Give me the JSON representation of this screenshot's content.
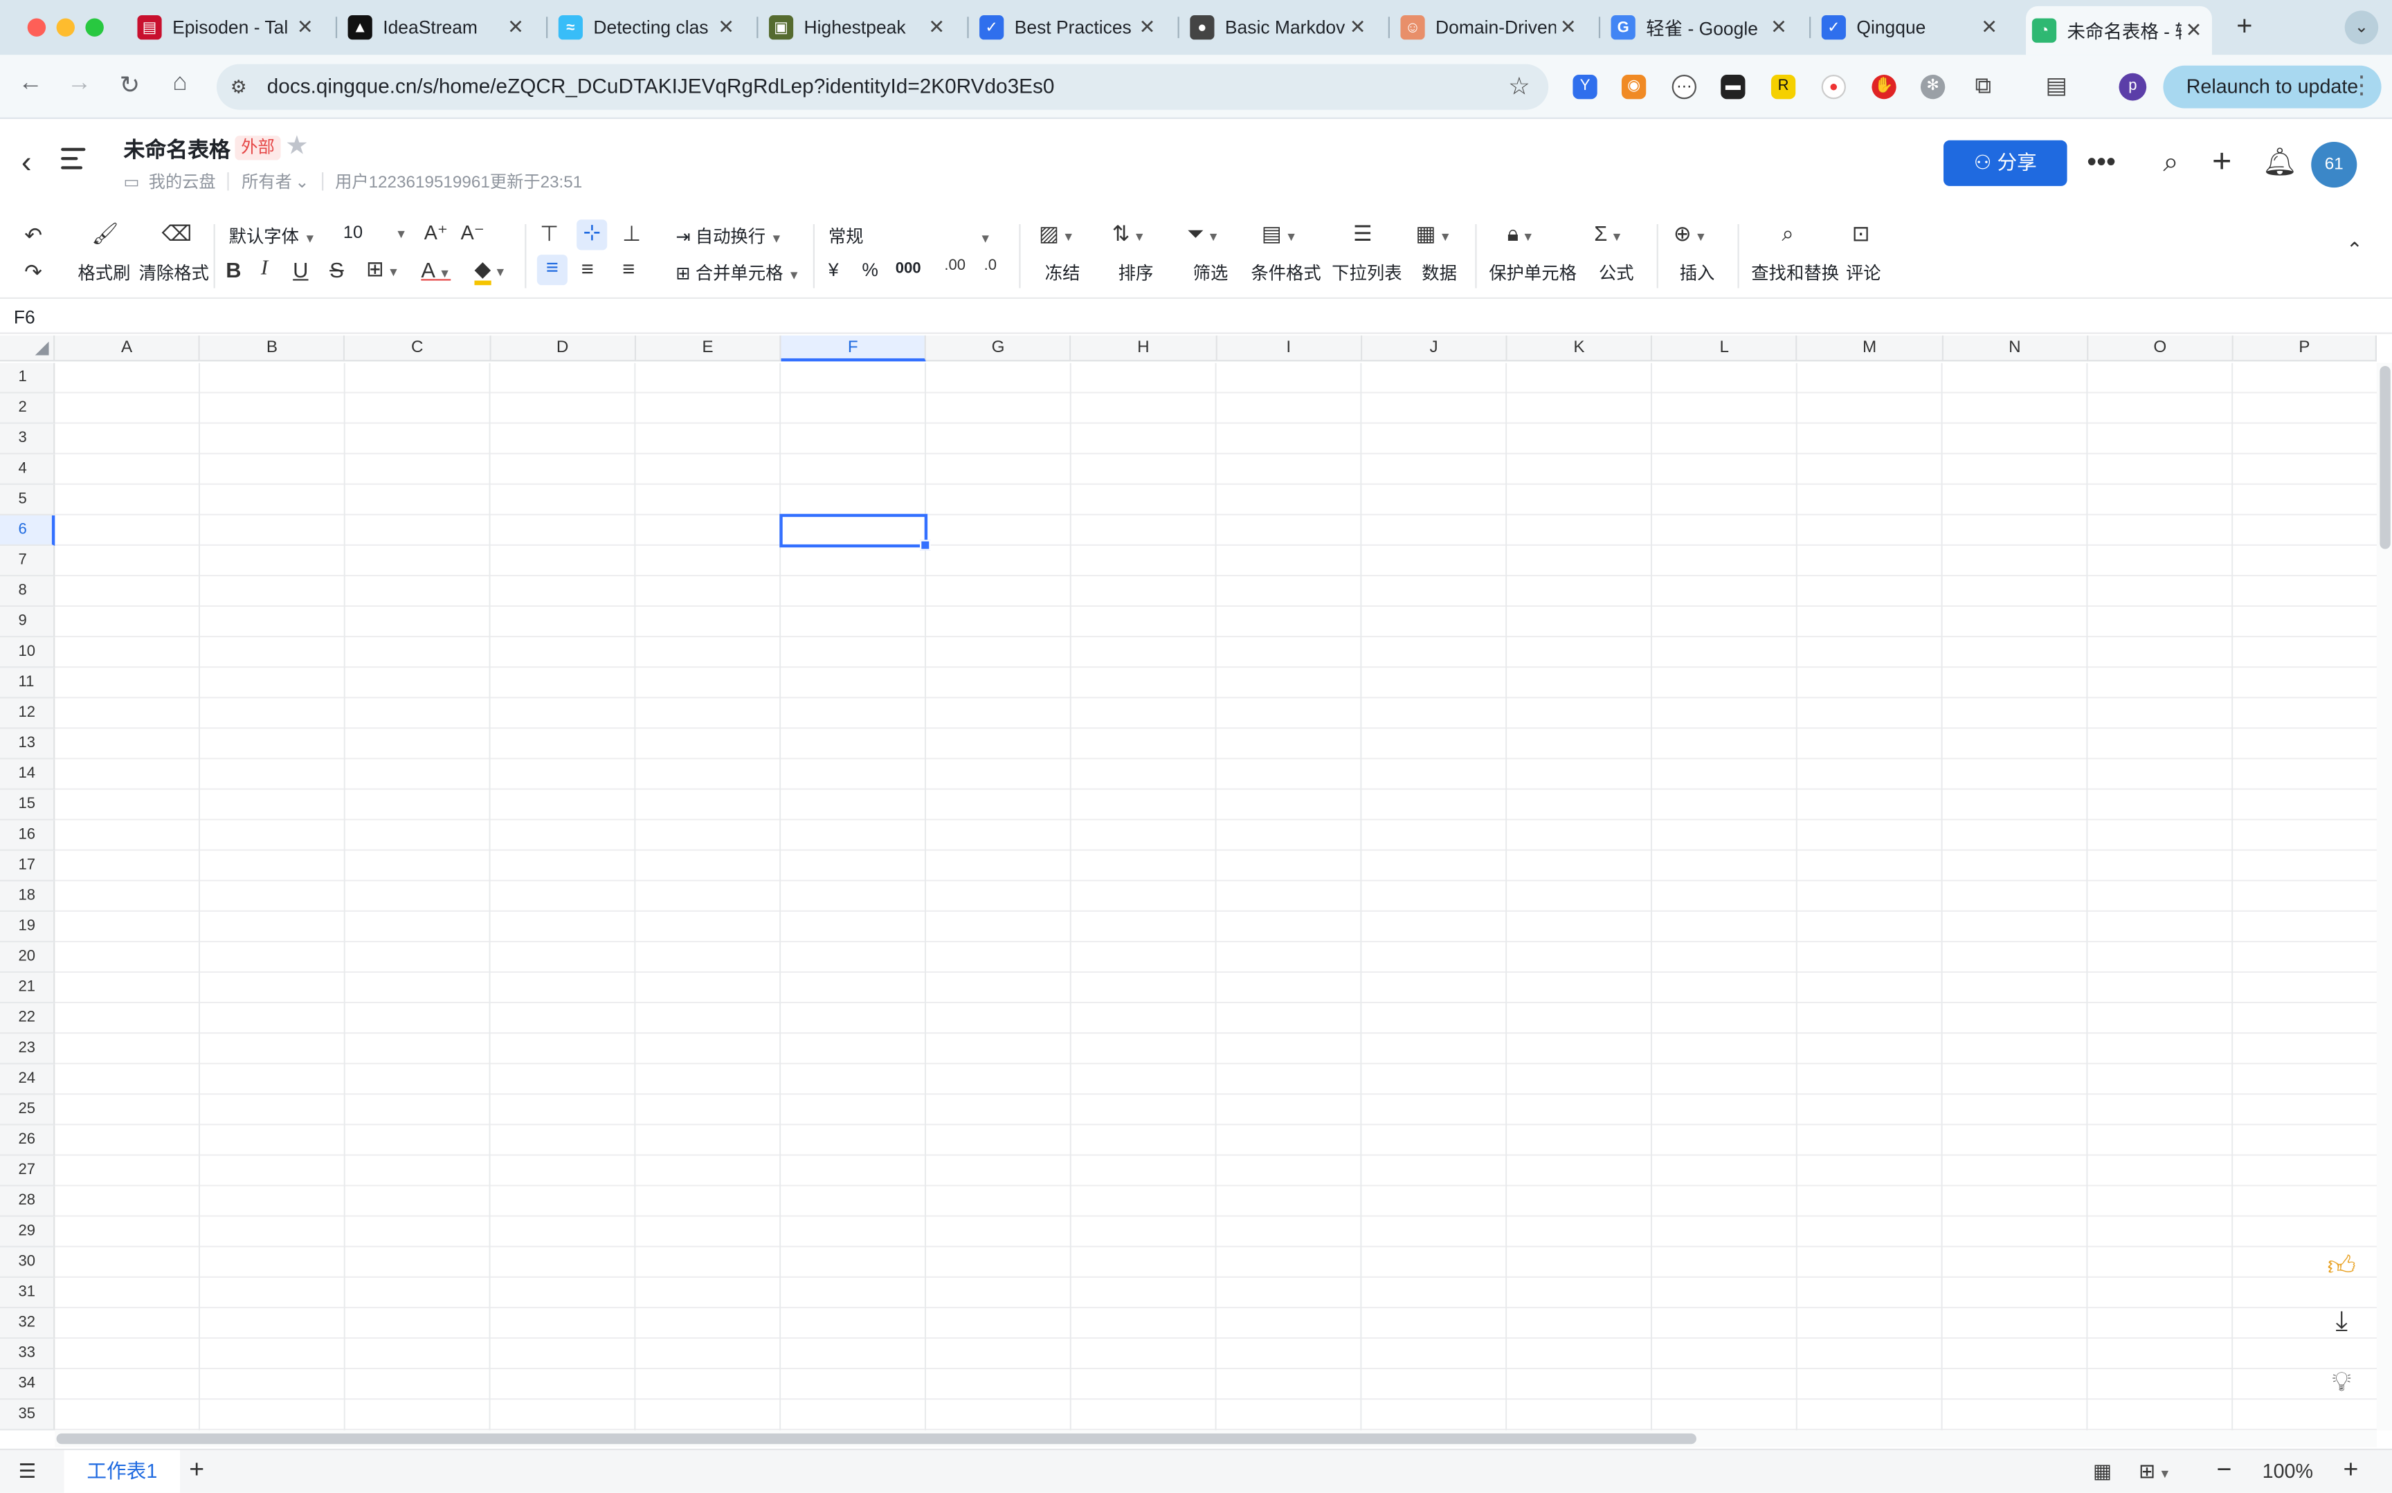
{
  "browser": {
    "tabs": [
      {
        "label": "Episoden - Tal",
        "icon": "flag-us-icon",
        "color": "#c8102e"
      },
      {
        "label": "IdeaStream",
        "icon": "triangle-logo-icon",
        "color": "#111111"
      },
      {
        "label": "Detecting clas",
        "icon": "wave-icon",
        "color": "#38bdf8"
      },
      {
        "label": "Highestpeak",
        "icon": "photo-icon",
        "color": "#556b2f"
      },
      {
        "label": "Best Practices",
        "icon": "bird-icon",
        "color": "#2f6fed"
      },
      {
        "label": "Basic Markdov",
        "icon": "person-icon",
        "color": "#444444"
      },
      {
        "label": "Domain-Driven",
        "icon": "face-icon",
        "color": "#e88f6a"
      },
      {
        "label": "轻雀 - Google",
        "icon": "google-icon",
        "color": "#4285f4"
      },
      {
        "label": "Qingque",
        "icon": "bird-icon",
        "color": "#2f6fed"
      },
      {
        "label": "未命名表格 - 轻",
        "icon": "sheet-logo-icon",
        "color": "#2eb872"
      }
    ],
    "url": "docs.qingque.cn/s/home/eZQCR_DCuDTAKIJEVqRgRdLep?identityId=2K0RVdo3Es0",
    "relaunch_label": "Relaunch to update",
    "profile_initial": "p"
  },
  "doc": {
    "title": "未命名表格",
    "badge": "外部",
    "location": "我的云盘",
    "permission": "所有者",
    "updated": "用户1223619519961更新于23:51",
    "share_label": "分享",
    "avatar": "61"
  },
  "toolbar": {
    "format_painter": "格式刷",
    "clear_format": "清除格式",
    "font": "默认字体",
    "font_size": "10",
    "wrap": "自动换行",
    "merge": "合并单元格",
    "number_format": "常规",
    "currency": "¥",
    "percent": "%",
    "thousands": "000",
    "freeze": "冻结",
    "sort": "排序",
    "filter": "筛选",
    "conditional": "条件格式",
    "dropdown": "下拉列表",
    "data": "数据",
    "protect": "保护单元格",
    "formula": "公式",
    "insert": "插入",
    "find_replace": "查找和替换",
    "comment": "评论"
  },
  "sheet": {
    "name_box": "F6",
    "columns": [
      "A",
      "B",
      "C",
      "D",
      "E",
      "F",
      "G",
      "H",
      "I",
      "J",
      "K",
      "L",
      "M",
      "N",
      "O",
      "P"
    ],
    "rows": [
      "1",
      "2",
      "3",
      "4",
      "5",
      "6",
      "7",
      "8",
      "9",
      "10",
      "11",
      "12",
      "13",
      "14",
      "15",
      "16",
      "17",
      "18",
      "19",
      "20",
      "21",
      "22",
      "23",
      "24",
      "25",
      "26",
      "27",
      "28",
      "29",
      "30",
      "31",
      "32",
      "33",
      "34",
      "35"
    ],
    "selected_column": "F",
    "selected_row": "6",
    "tab_name": "工作表1",
    "zoom": "100%"
  }
}
